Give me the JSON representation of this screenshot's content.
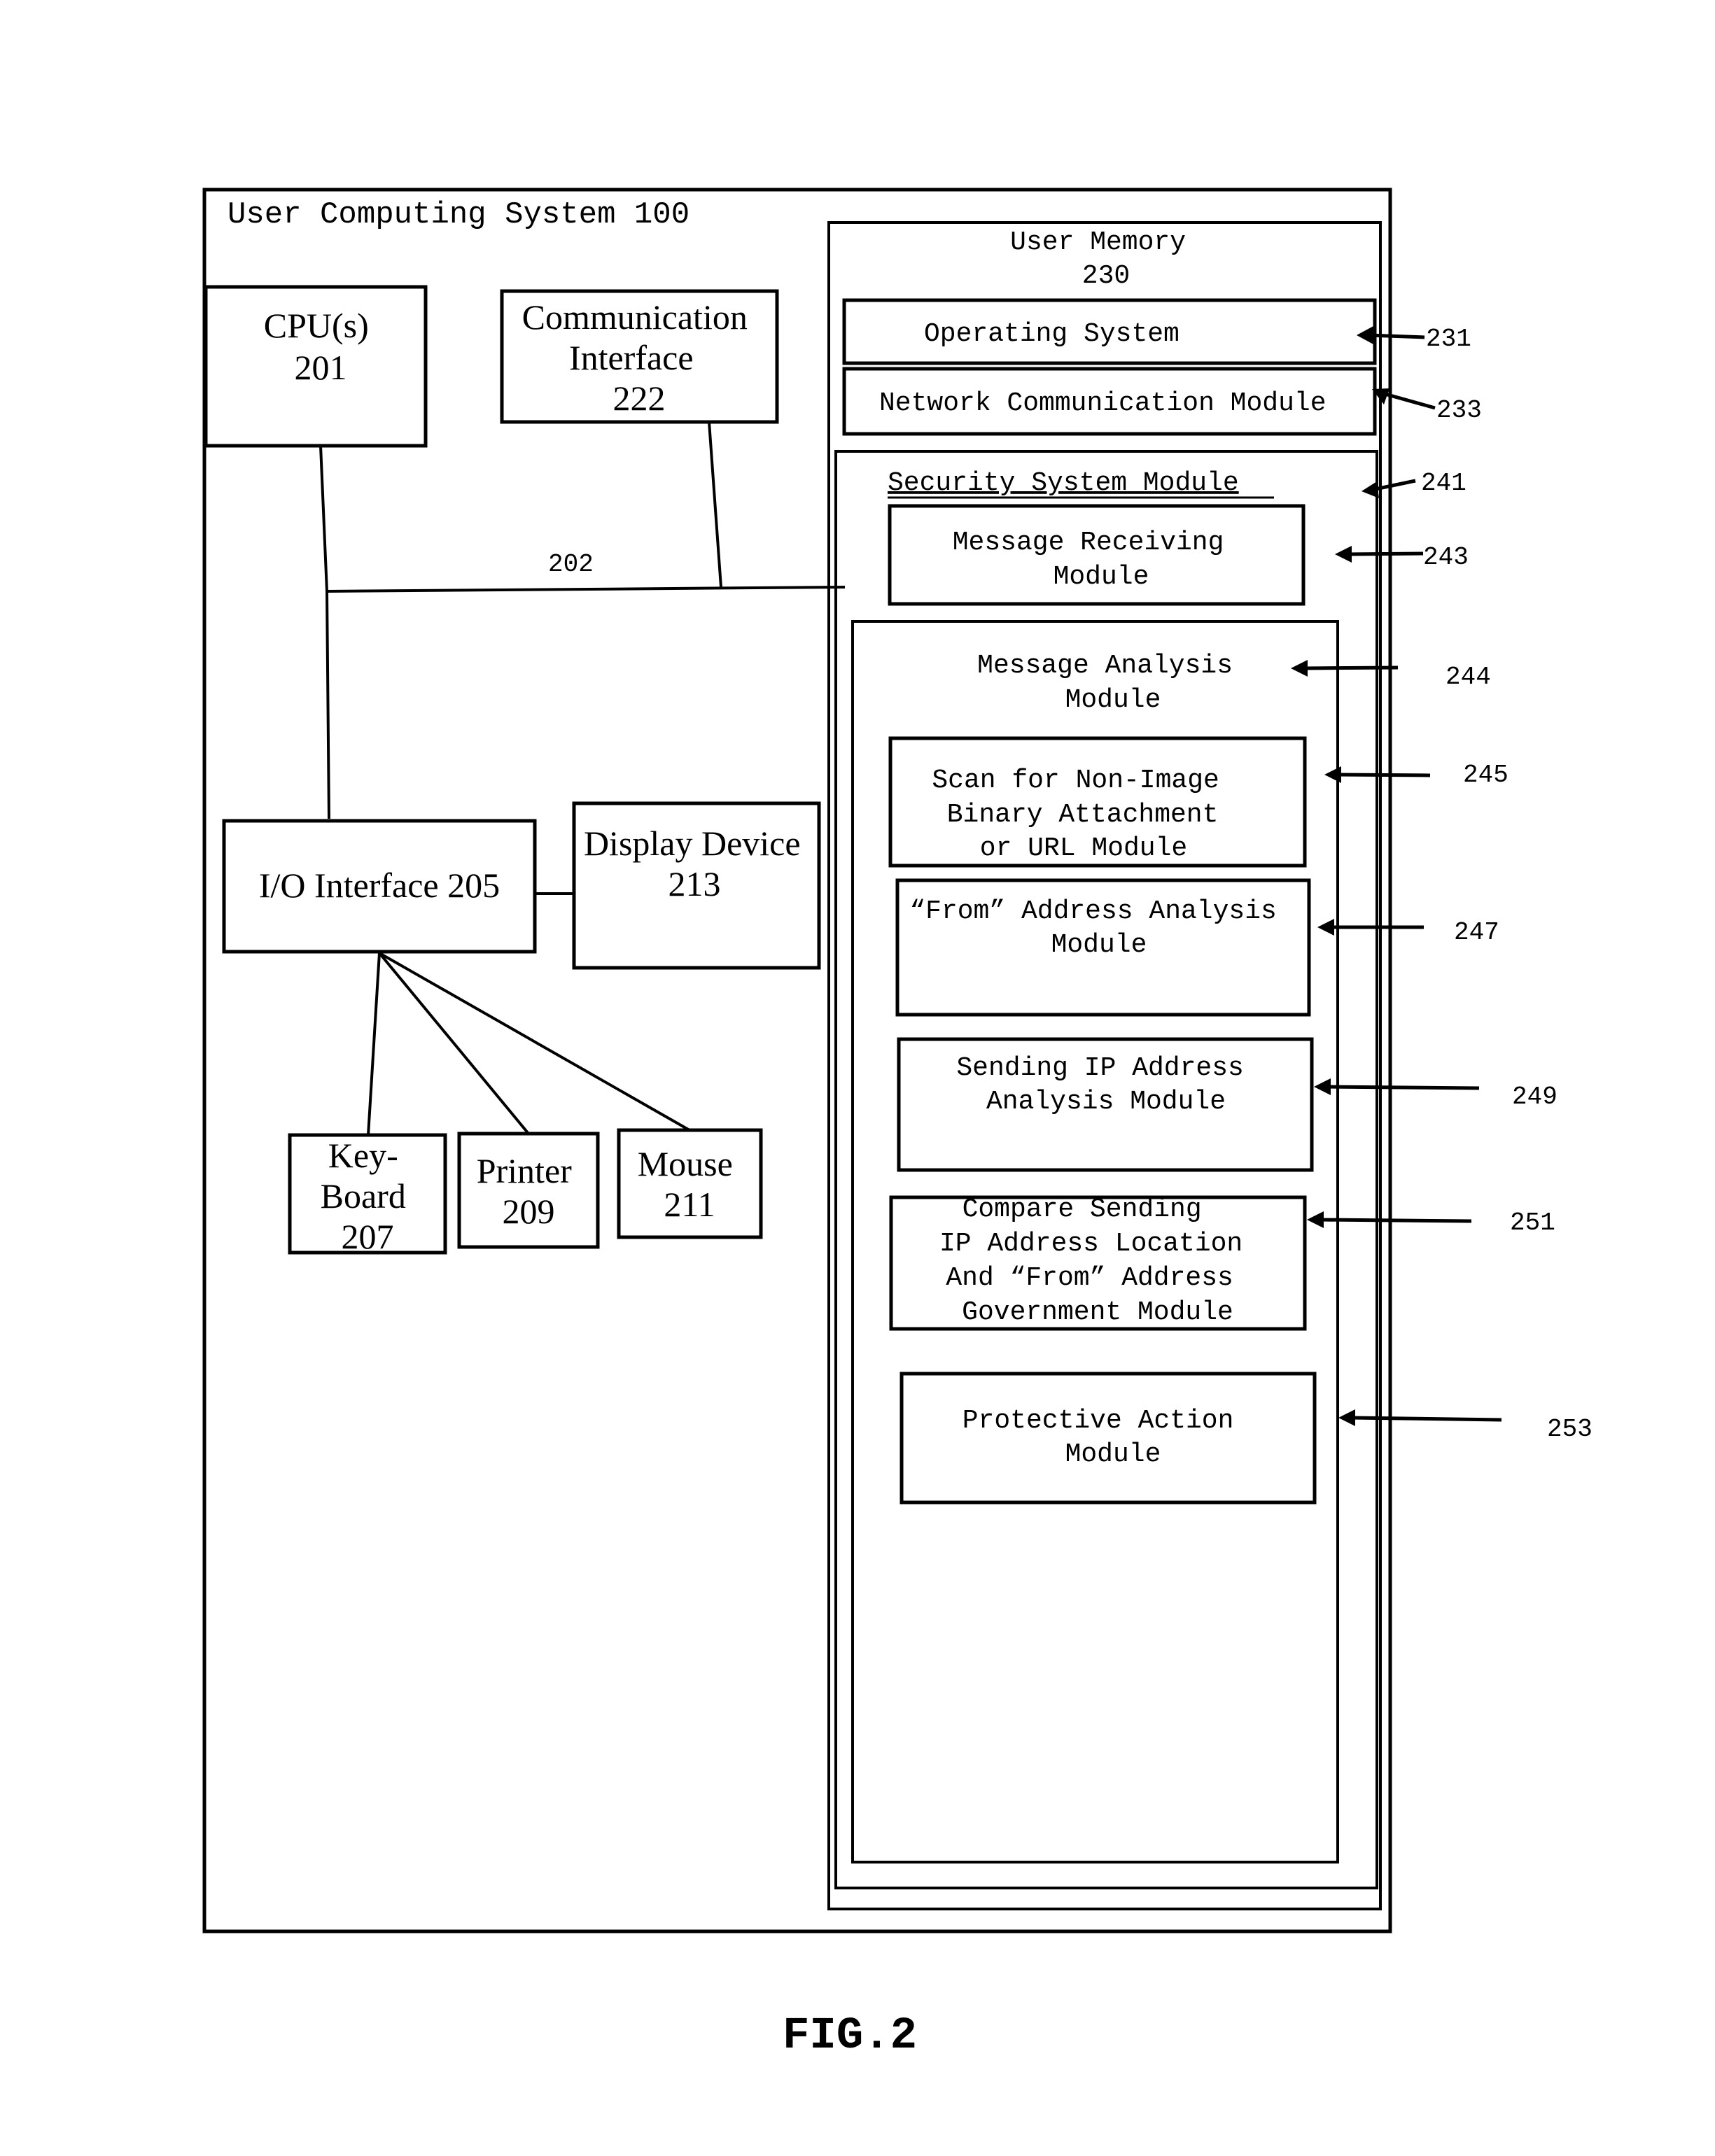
{
  "figure": {
    "caption": "FIG.2",
    "system_title": "User Computing System 100",
    "bus_label": "202"
  },
  "hardware": {
    "cpu": {
      "lines": [
        "CPU(s)",
        "201"
      ]
    },
    "comm_interface": {
      "lines": [
        "Communication",
        "Interface",
        "222"
      ]
    },
    "io_interface": {
      "lines": [
        "I/O Interface 205"
      ]
    },
    "display": {
      "lines": [
        "Display Device",
        "213"
      ]
    },
    "keyboard": {
      "lines": [
        "Key-",
        "Board",
        "207"
      ]
    },
    "printer": {
      "lines": [
        "Printer",
        "209"
      ]
    },
    "mouse": {
      "lines": [
        "Mouse",
        "211"
      ]
    }
  },
  "memory": {
    "title_lines": [
      "User Memory",
      "230"
    ],
    "operating_system": {
      "label": "Operating System",
      "ref": "231"
    },
    "network_comm": {
      "label": "Network Communication Module",
      "ref": "233"
    },
    "security": {
      "title": "Security System Module",
      "ref": "241",
      "message_receiving": {
        "lines": [
          "Message Receiving",
          "Module"
        ],
        "ref": "243"
      },
      "message_analysis": {
        "lines": [
          "Message Analysis",
          "Module"
        ],
        "ref": "244",
        "scan": {
          "lines": [
            "Scan for Non-Image",
            "Binary Attachment",
            "or URL Module"
          ],
          "ref": "245"
        },
        "from_address": {
          "lines": [
            "“From” Address Analysis",
            "Module"
          ],
          "ref": "247"
        },
        "sending_ip": {
          "lines": [
            "Sending IP Address",
            "Analysis Module"
          ],
          "ref": "249"
        },
        "compare": {
          "lines": [
            "Compare Sending",
            "IP Address Location",
            "And “From” Address",
            "Government Module"
          ],
          "ref": "251"
        },
        "protective": {
          "lines": [
            "Protective Action",
            "Module"
          ],
          "ref": "253"
        }
      }
    }
  }
}
